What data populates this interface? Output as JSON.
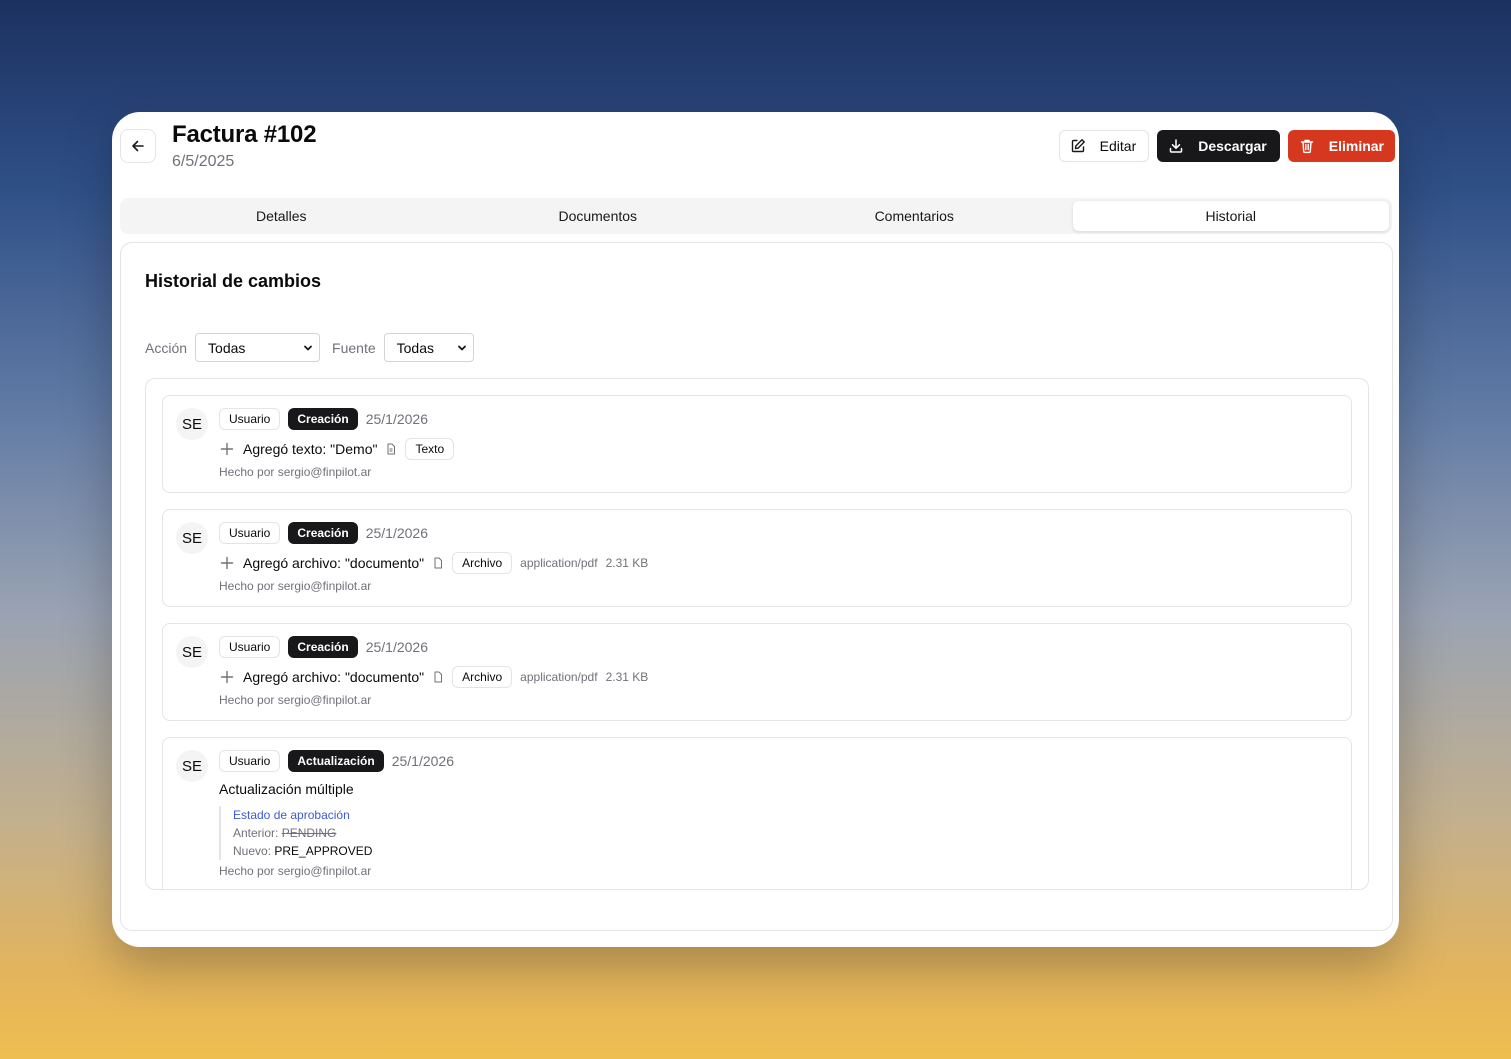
{
  "header": {
    "title": "Factura #102",
    "date": "6/5/2025",
    "actions": {
      "edit_label": "Editar",
      "download_label": "Descargar",
      "delete_label": "Eliminar"
    }
  },
  "tabs": [
    {
      "label": "Detalles",
      "active": false
    },
    {
      "label": "Documentos",
      "active": false
    },
    {
      "label": "Comentarios",
      "active": false
    },
    {
      "label": "Historial",
      "active": true
    }
  ],
  "history": {
    "title": "Historial de cambios",
    "filters": {
      "action_label": "Acción",
      "action_value": "Todas",
      "source_label": "Fuente",
      "source_value": "Todas"
    },
    "entries": [
      {
        "avatar": "SE",
        "source": "Usuario",
        "action": "Creación",
        "date": "25/1/2026",
        "summary": "Agregó texto: \"Demo\"",
        "type": "Texto",
        "by": "Hecho por sergio@finpilot.ar"
      },
      {
        "avatar": "SE",
        "source": "Usuario",
        "action": "Creación",
        "date": "25/1/2026",
        "summary": "Agregó archivo: \"documento\"",
        "type": "Archivo",
        "mime": "application/pdf",
        "size": "2.31 KB",
        "by": "Hecho por sergio@finpilot.ar"
      },
      {
        "avatar": "SE",
        "source": "Usuario",
        "action": "Creación",
        "date": "25/1/2026",
        "summary": "Agregó archivo: \"documento\"",
        "type": "Archivo",
        "mime": "application/pdf",
        "size": "2.31 KB",
        "by": "Hecho por sergio@finpilot.ar"
      },
      {
        "avatar": "SE",
        "source": "Usuario",
        "action": "Actualización",
        "date": "25/1/2026",
        "summary": "Actualización múltiple",
        "field": "Estado de aprobación",
        "previous_label": "Anterior:",
        "previous_value": "PENDING",
        "new_label": "Nuevo:",
        "new_value": "PRE_APPROVED",
        "by": "Hecho por sergio@finpilot.ar"
      }
    ]
  },
  "icons": {
    "back": "arrow-left-icon",
    "edit": "pencil-square-icon",
    "download": "download-icon",
    "delete": "trash-icon",
    "add": "plus-icon",
    "file": "file-icon",
    "dropdown": "chevron-down-icon"
  },
  "colors": {
    "primary_dark": "#18181b",
    "danger": "#d5381f",
    "link": "#3b5bdb",
    "border": "#e4e4e7",
    "muted": "#71717a"
  }
}
